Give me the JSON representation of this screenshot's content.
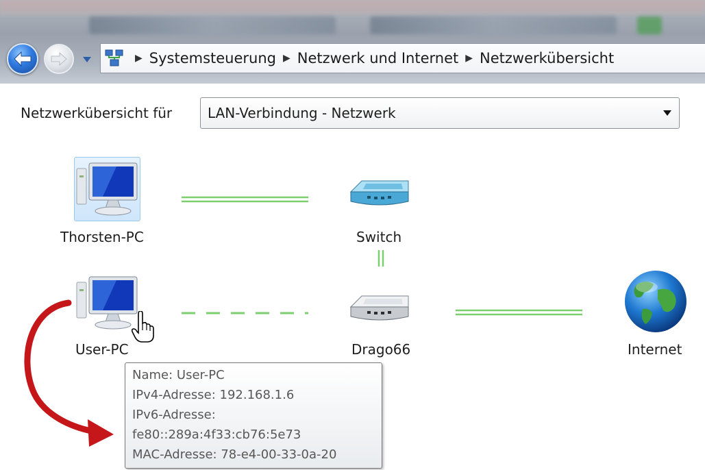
{
  "breadcrumb": [
    "Systemsteuerung",
    "Netzwerk und Internet",
    "Netzwerkübersicht"
  ],
  "overview": {
    "label": "Netzwerkübersicht für",
    "selected_network": "LAN-Verbindung - Netzwerk"
  },
  "map": {
    "nodes": {
      "thorsten_pc": "Thorsten-PC",
      "switch": "Switch",
      "user_pc": "User-PC",
      "router": "Drago66",
      "internet": "Internet"
    }
  },
  "tooltip": {
    "name": "Name: User-PC",
    "ipv4": "IPv4-Adresse: 192.168.1.6",
    "ipv6_label": "IPv6-Adresse:",
    "ipv6_value": "fe80::289a:4f33:cb76:5e73",
    "mac": "MAC-Adresse: 78-e4-00-33-0a-20"
  },
  "colors": {
    "link_line": "#7ccf6f",
    "annotation_arrow": "#c5161a",
    "selection_highlight": "#cfe6fb"
  }
}
